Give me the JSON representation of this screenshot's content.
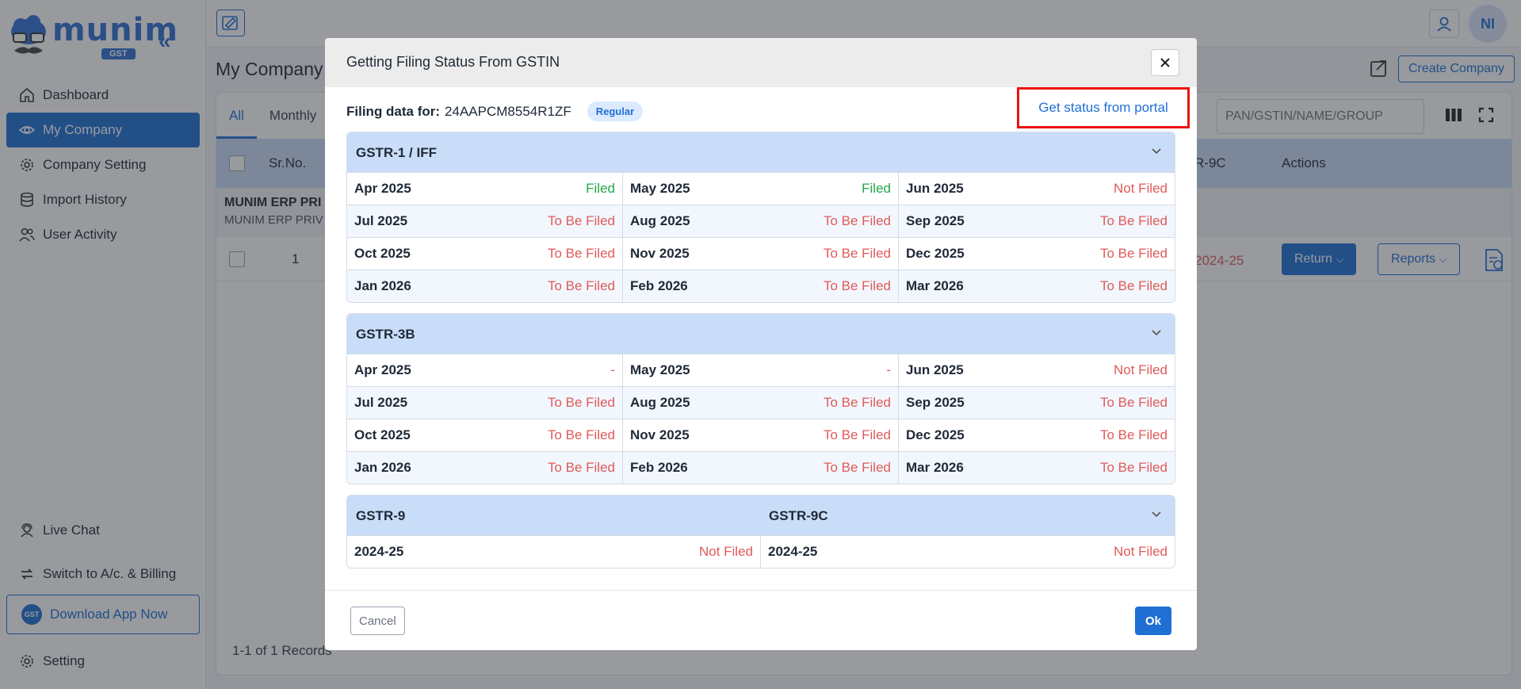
{
  "brand": {
    "name": "munim",
    "badge": "GST"
  },
  "sidebar": {
    "collapse_icon": "double-chevron-left-icon",
    "items": [
      {
        "label": "Dashboard",
        "icon": "home-icon"
      },
      {
        "label": "My Company",
        "icon": "eye-icon",
        "active": true
      },
      {
        "label": "Company Setting",
        "icon": "gear-icon"
      },
      {
        "label": "Import History",
        "icon": "database-icon"
      },
      {
        "label": "User Activity",
        "icon": "users-icon"
      }
    ],
    "bottom": {
      "live_chat": "Live Chat",
      "switch_billing": "Switch to A/c. & Billing",
      "download_app": "Download App Now",
      "download_badge": "GST",
      "setting": "Setting"
    }
  },
  "topbar": {
    "avatar_initials": "NI"
  },
  "page": {
    "title": "My Company",
    "create_button": "Create Company",
    "tabs": [
      "All",
      "Monthly"
    ],
    "search_placeholder": "PAN/GSTIN/NAME/GROUP",
    "table": {
      "headers": {
        "srno": "Sr.No.",
        "gstr9c": "R-9C",
        "actions": "Actions"
      },
      "group": {
        "name": "MUNIM ERP PRI",
        "sub": "MUNIM ERP PRIV"
      },
      "row": {
        "srno": "1",
        "status": "2024-25",
        "return_button": "Return",
        "reports_button": "Reports"
      }
    },
    "records": "1-1 of 1 Records"
  },
  "modal": {
    "title": "Getting Filing Status From GSTIN",
    "filing_label": "Filing data for:",
    "gstin": "24AAPCM8554R1ZF",
    "badge": "Regular",
    "portal_link": "Get status from portal",
    "sections": {
      "gstr1": {
        "title": "GSTR-1 / IFF",
        "cells": [
          {
            "month": "Apr 2025",
            "status": "Filed"
          },
          {
            "month": "May 2025",
            "status": "Filed"
          },
          {
            "month": "Jun 2025",
            "status": "Not Filed"
          },
          {
            "month": "Jul 2025",
            "status": "To Be Filed"
          },
          {
            "month": "Aug 2025",
            "status": "To Be Filed"
          },
          {
            "month": "Sep 2025",
            "status": "To Be Filed"
          },
          {
            "month": "Oct 2025",
            "status": "To Be Filed"
          },
          {
            "month": "Nov 2025",
            "status": "To Be Filed"
          },
          {
            "month": "Dec 2025",
            "status": "To Be Filed"
          },
          {
            "month": "Jan 2026",
            "status": "To Be Filed"
          },
          {
            "month": "Feb 2026",
            "status": "To Be Filed"
          },
          {
            "month": "Mar 2026",
            "status": "To Be Filed"
          }
        ]
      },
      "gstr3b": {
        "title": "GSTR-3B",
        "cells": [
          {
            "month": "Apr 2025",
            "status": "-"
          },
          {
            "month": "May 2025",
            "status": "-"
          },
          {
            "month": "Jun 2025",
            "status": "Not Filed"
          },
          {
            "month": "Jul 2025",
            "status": "To Be Filed"
          },
          {
            "month": "Aug 2025",
            "status": "To Be Filed"
          },
          {
            "month": "Sep 2025",
            "status": "To Be Filed"
          },
          {
            "month": "Oct 2025",
            "status": "To Be Filed"
          },
          {
            "month": "Nov 2025",
            "status": "To Be Filed"
          },
          {
            "month": "Dec 2025",
            "status": "To Be Filed"
          },
          {
            "month": "Jan 2026",
            "status": "To Be Filed"
          },
          {
            "month": "Feb 2026",
            "status": "To Be Filed"
          },
          {
            "month": "Mar 2026",
            "status": "To Be Filed"
          }
        ]
      },
      "gstr9": {
        "title": "GSTR-9",
        "title2": "GSTR-9C",
        "cells": [
          {
            "month": "2024-25",
            "status": "Not Filed"
          },
          {
            "month": "2024-25",
            "status": "Not Filed"
          }
        ]
      }
    },
    "cancel_button": "Cancel",
    "ok_button": "Ok"
  },
  "colors": {
    "accent": "#1f6fd4",
    "filed": "#22a846",
    "not_filed": "#e05a5a",
    "highlight": "#ee1111"
  }
}
